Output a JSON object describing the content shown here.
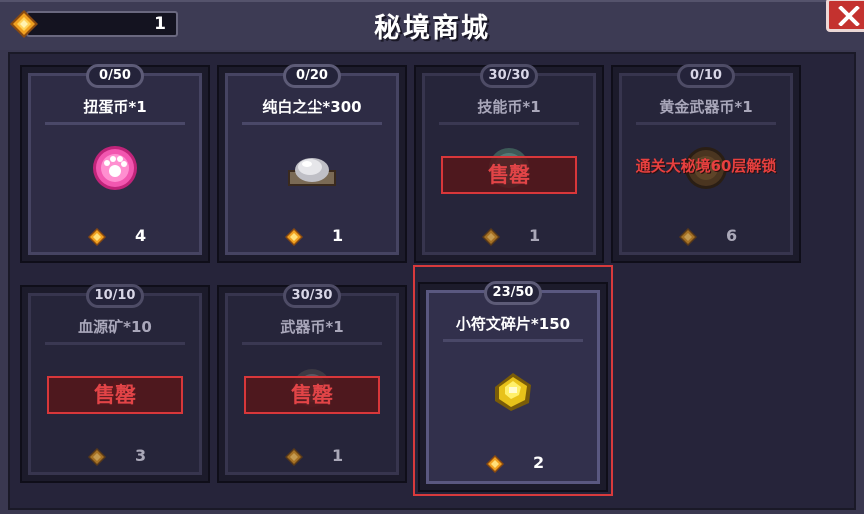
{
  "header": {
    "title": "秘境商城",
    "currency_value": "1",
    "currency_icon": "gem-icon",
    "close_icon": "close-icon"
  },
  "colors": {
    "sold_out_red": "#d8373a",
    "locked_text_red": "#e8403f",
    "selection_red": "#d83a3c",
    "close_button_red": "#c4322f",
    "gem_orange": "#f0a020"
  },
  "items": [
    {
      "stock": "0/50",
      "name": "扭蛋币*1",
      "price": "4",
      "icon": "pink-gacha-coin-icon",
      "state": "available"
    },
    {
      "stock": "0/20",
      "name": "纯白之尘*300",
      "price": "1",
      "icon": "white-dust-pile-icon",
      "state": "available"
    },
    {
      "stock": "30/30",
      "name": "技能币*1",
      "price": "1",
      "icon": "skill-coin-icon",
      "state": "sold_out",
      "sold_label": "售罄"
    },
    {
      "stock": "0/10",
      "name": "黄金武器币*1",
      "price": "6",
      "icon": "gold-weapon-coin-icon",
      "state": "locked",
      "lock_text": "通关大秘境60层解锁"
    },
    {
      "stock": "10/10",
      "name": "血源矿*10",
      "price": "3",
      "icon": "blood-ore-icon",
      "state": "sold_out",
      "sold_label": "售罄"
    },
    {
      "stock": "30/30",
      "name": "武器币*1",
      "price": "1",
      "icon": "weapon-coin-icon",
      "state": "sold_out",
      "sold_label": "售罄"
    },
    {
      "stock": "23/50",
      "name": "小符文碎片*150",
      "price": "2",
      "icon": "rune-shard-icon",
      "state": "selected"
    }
  ]
}
